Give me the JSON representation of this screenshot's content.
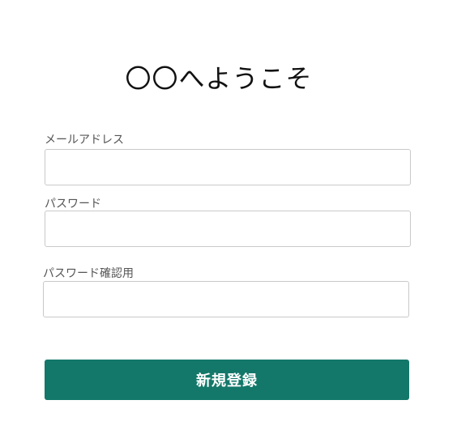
{
  "form": {
    "title": "〇〇へようこそ",
    "email": {
      "label": "メールアドレス",
      "value": "",
      "placeholder": ""
    },
    "password": {
      "label": "パスワード",
      "value": "",
      "placeholder": ""
    },
    "password_confirm": {
      "label": "パスワード確認用",
      "value": "",
      "placeholder": ""
    },
    "submit_label": "新規登録"
  },
  "colors": {
    "background": "#ffffff",
    "button": "#13786a",
    "button_text": "#ffffff",
    "label_text": "#555555",
    "input_border": "#c9c9c9"
  }
}
